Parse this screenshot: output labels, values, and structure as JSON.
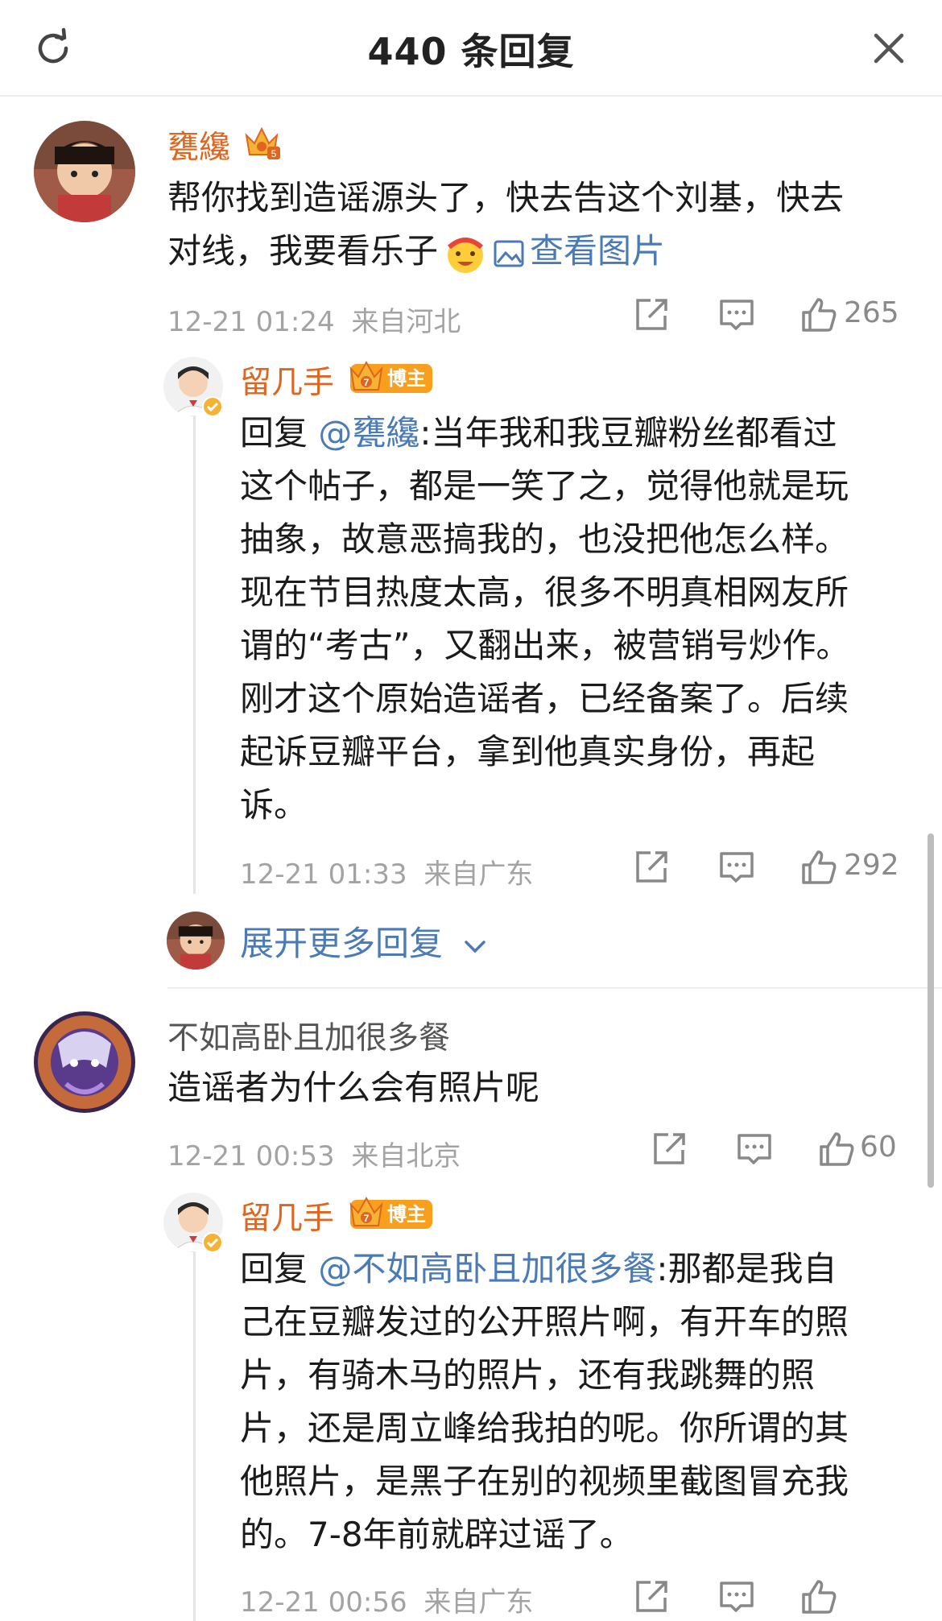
{
  "header": {
    "title": "440 条回复"
  },
  "comments": [
    {
      "username": "甕纔",
      "text": "帮你找到造谣源头了，快去告这个刘基，快去对线，我要看乐子",
      "text_line1": "帮你找到造谣源头了，快去告这个刘基，快去",
      "text_line2": "对线，我要看乐子",
      "view_image": "查看图片",
      "time": "12-21 01:24",
      "location": "来自河北",
      "likes": "265",
      "reply": {
        "username": "留几手",
        "badge": "博主",
        "reply_prefix": "回复 ",
        "mention": "@甕纔",
        "lines": [
          ":当年我和我豆瓣粉丝都看过",
          "这个帖子，都是一笑了之，觉得他就是玩",
          "抽象，故意恶搞我的，也没把他怎么样。",
          "现在节目热度太高，很多不明真相网友所",
          "谓的“考古”，又翻出来，被营销号炒作。",
          "刚才这个原始造谣者，已经备案了。后续",
          "起诉豆瓣平台，拿到他真实身份，再起",
          "诉。"
        ],
        "time": "12-21 01:33",
        "location": "来自广东",
        "likes": "292"
      },
      "expand_label": "展开更多回复"
    },
    {
      "username": "不如高卧且加很多餐",
      "text": "造谣者为什么会有照片呢",
      "time": "12-21 00:53",
      "location": "来自北京",
      "likes": "60",
      "reply": {
        "username": "留几手",
        "badge": "博主",
        "reply_prefix": "回复 ",
        "mention": "@不如高卧且加很多餐",
        "lines": [
          ":那都是我自",
          "己在豆瓣发过的公开照片啊，有开车的照",
          "片，有骑木马的照片，还有我跳舞的照",
          "片，还是周立峰给我拍的呢。你所谓的其",
          "他照片，是黑子在别的视频里截图冒充我",
          "的。7-8年前就辟过谣了。"
        ],
        "time": "12-21 00:56",
        "location": "来自广东"
      }
    }
  ],
  "icons": [
    "refresh-icon",
    "close-icon",
    "share-icon",
    "comment-icon",
    "like-icon",
    "chevron-down-icon",
    "image-icon",
    "crown-icon",
    "verified-icon"
  ],
  "colors": {
    "username": "#e0651f",
    "link": "#4a7bb7",
    "meta": "#a3a3a3",
    "badge": "#f8a01e"
  }
}
